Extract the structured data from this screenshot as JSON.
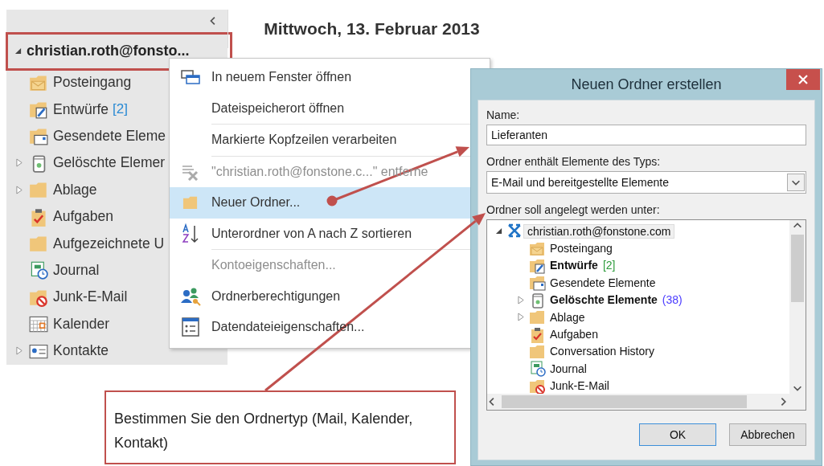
{
  "navigation_pane": {
    "account": "christian.roth@fonsto...",
    "account_expanded": true,
    "folders": [
      {
        "label": "Posteingang",
        "kind": "inbox",
        "expandable": false
      },
      {
        "label": "Entwürfe",
        "count": "[2]",
        "kind": "drafts",
        "expandable": false
      },
      {
        "label": "Gesendete Eleme",
        "kind": "sent",
        "expandable": false
      },
      {
        "label": "Gelöschte Elemer",
        "kind": "deleted",
        "expandable": true
      },
      {
        "label": "Ablage",
        "kind": "folder",
        "expandable": true
      },
      {
        "label": "Aufgaben",
        "kind": "tasks",
        "expandable": false
      },
      {
        "label": "Aufgezeichnete U",
        "kind": "folder",
        "expandable": false
      },
      {
        "label": "Journal",
        "kind": "journal",
        "expandable": false
      },
      {
        "label": "Junk-E-Mail",
        "kind": "junk",
        "expandable": false
      },
      {
        "label": "Kalender",
        "kind": "calendar",
        "expandable": false
      },
      {
        "label": "Kontakte",
        "kind": "contacts",
        "expandable": true
      }
    ]
  },
  "calendar_header": {
    "date": "Mittwoch, 13. Februar 2013"
  },
  "context_menu": {
    "items": [
      {
        "label": "In neuem Fenster öffnen",
        "kind": "window",
        "disabled": false,
        "selected": false,
        "separator_before": false
      },
      {
        "label": "Dateispeicherort öffnen",
        "kind": "plain",
        "disabled": false,
        "selected": false,
        "separator_before": false
      },
      {
        "label": "Markierte Kopfzeilen verarbeiten",
        "kind": "plain",
        "disabled": false,
        "selected": false,
        "separator_before": true
      },
      {
        "label": "\"christian.roth@fonstone.c...\" entferne",
        "kind": "remove",
        "disabled": true,
        "selected": false,
        "separator_before": true
      },
      {
        "label": "Neuer Ordner...",
        "kind": "folder",
        "disabled": false,
        "selected": true,
        "separator_before": false
      },
      {
        "label": "Unterordner von A nach Z sortieren",
        "kind": "sort",
        "disabled": false,
        "selected": false,
        "separator_before": false
      },
      {
        "label": "Kontoeigenschaften...",
        "kind": "plain",
        "disabled": true,
        "selected": false,
        "separator_before": true
      },
      {
        "label": "Ordnerberechtigungen",
        "kind": "permissions",
        "disabled": false,
        "selected": false,
        "separator_before": false
      },
      {
        "label": "Datendateieigenschaften...",
        "kind": "properties",
        "disabled": false,
        "selected": false,
        "separator_before": false
      }
    ]
  },
  "dialog": {
    "title": "Neuen Ordner erstellen",
    "name_label": "Name:",
    "name_value": "Lieferanten",
    "type_label": "Ordner enthält Elemente des Typs:",
    "type_value": "E-Mail und bereitgestellte Elemente",
    "location_label": "Ordner soll angelegt werden unter:",
    "tree": [
      {
        "label": "christian.roth@fonstone.com",
        "kind": "account",
        "expandable": true,
        "expanded": true,
        "selected": true,
        "bold": false,
        "children": [
          {
            "label": "Posteingang",
            "kind": "inbox",
            "expandable": false,
            "selected": false,
            "bold": false
          },
          {
            "label": "Entwürfe",
            "count": {
              "text": "[2]",
              "color": "#2e9c3c"
            },
            "kind": "drafts",
            "expandable": false,
            "selected": false,
            "bold": true
          },
          {
            "label": "Gesendete Elemente",
            "kind": "sent",
            "expandable": false,
            "selected": false,
            "bold": false
          },
          {
            "label": "Gelöschte Elemente",
            "count": {
              "text": "(38)",
              "color": "#4b3cff"
            },
            "kind": "deleted",
            "expandable": true,
            "selected": false,
            "bold": true
          },
          {
            "label": "Ablage",
            "kind": "folder",
            "expandable": true,
            "selected": false,
            "bold": false
          },
          {
            "label": "Aufgaben",
            "kind": "tasks",
            "expandable": false,
            "selected": false,
            "bold": false
          },
          {
            "label": "Conversation History",
            "kind": "folder",
            "expandable": false,
            "selected": false,
            "bold": false
          },
          {
            "label": "Journal",
            "kind": "journal",
            "expandable": false,
            "selected": false,
            "bold": false
          },
          {
            "label": "Junk-E-Mail",
            "kind": "junk",
            "expandable": false,
            "selected": false,
            "bold": false
          }
        ]
      }
    ],
    "buttons": [
      {
        "label": "OK",
        "default": true
      },
      {
        "label": "Abbrechen",
        "default": false
      }
    ]
  },
  "callout": {
    "text": "Bestimmen Sie den Ordnertyp (Mail, Kalender, Kontakt)"
  }
}
